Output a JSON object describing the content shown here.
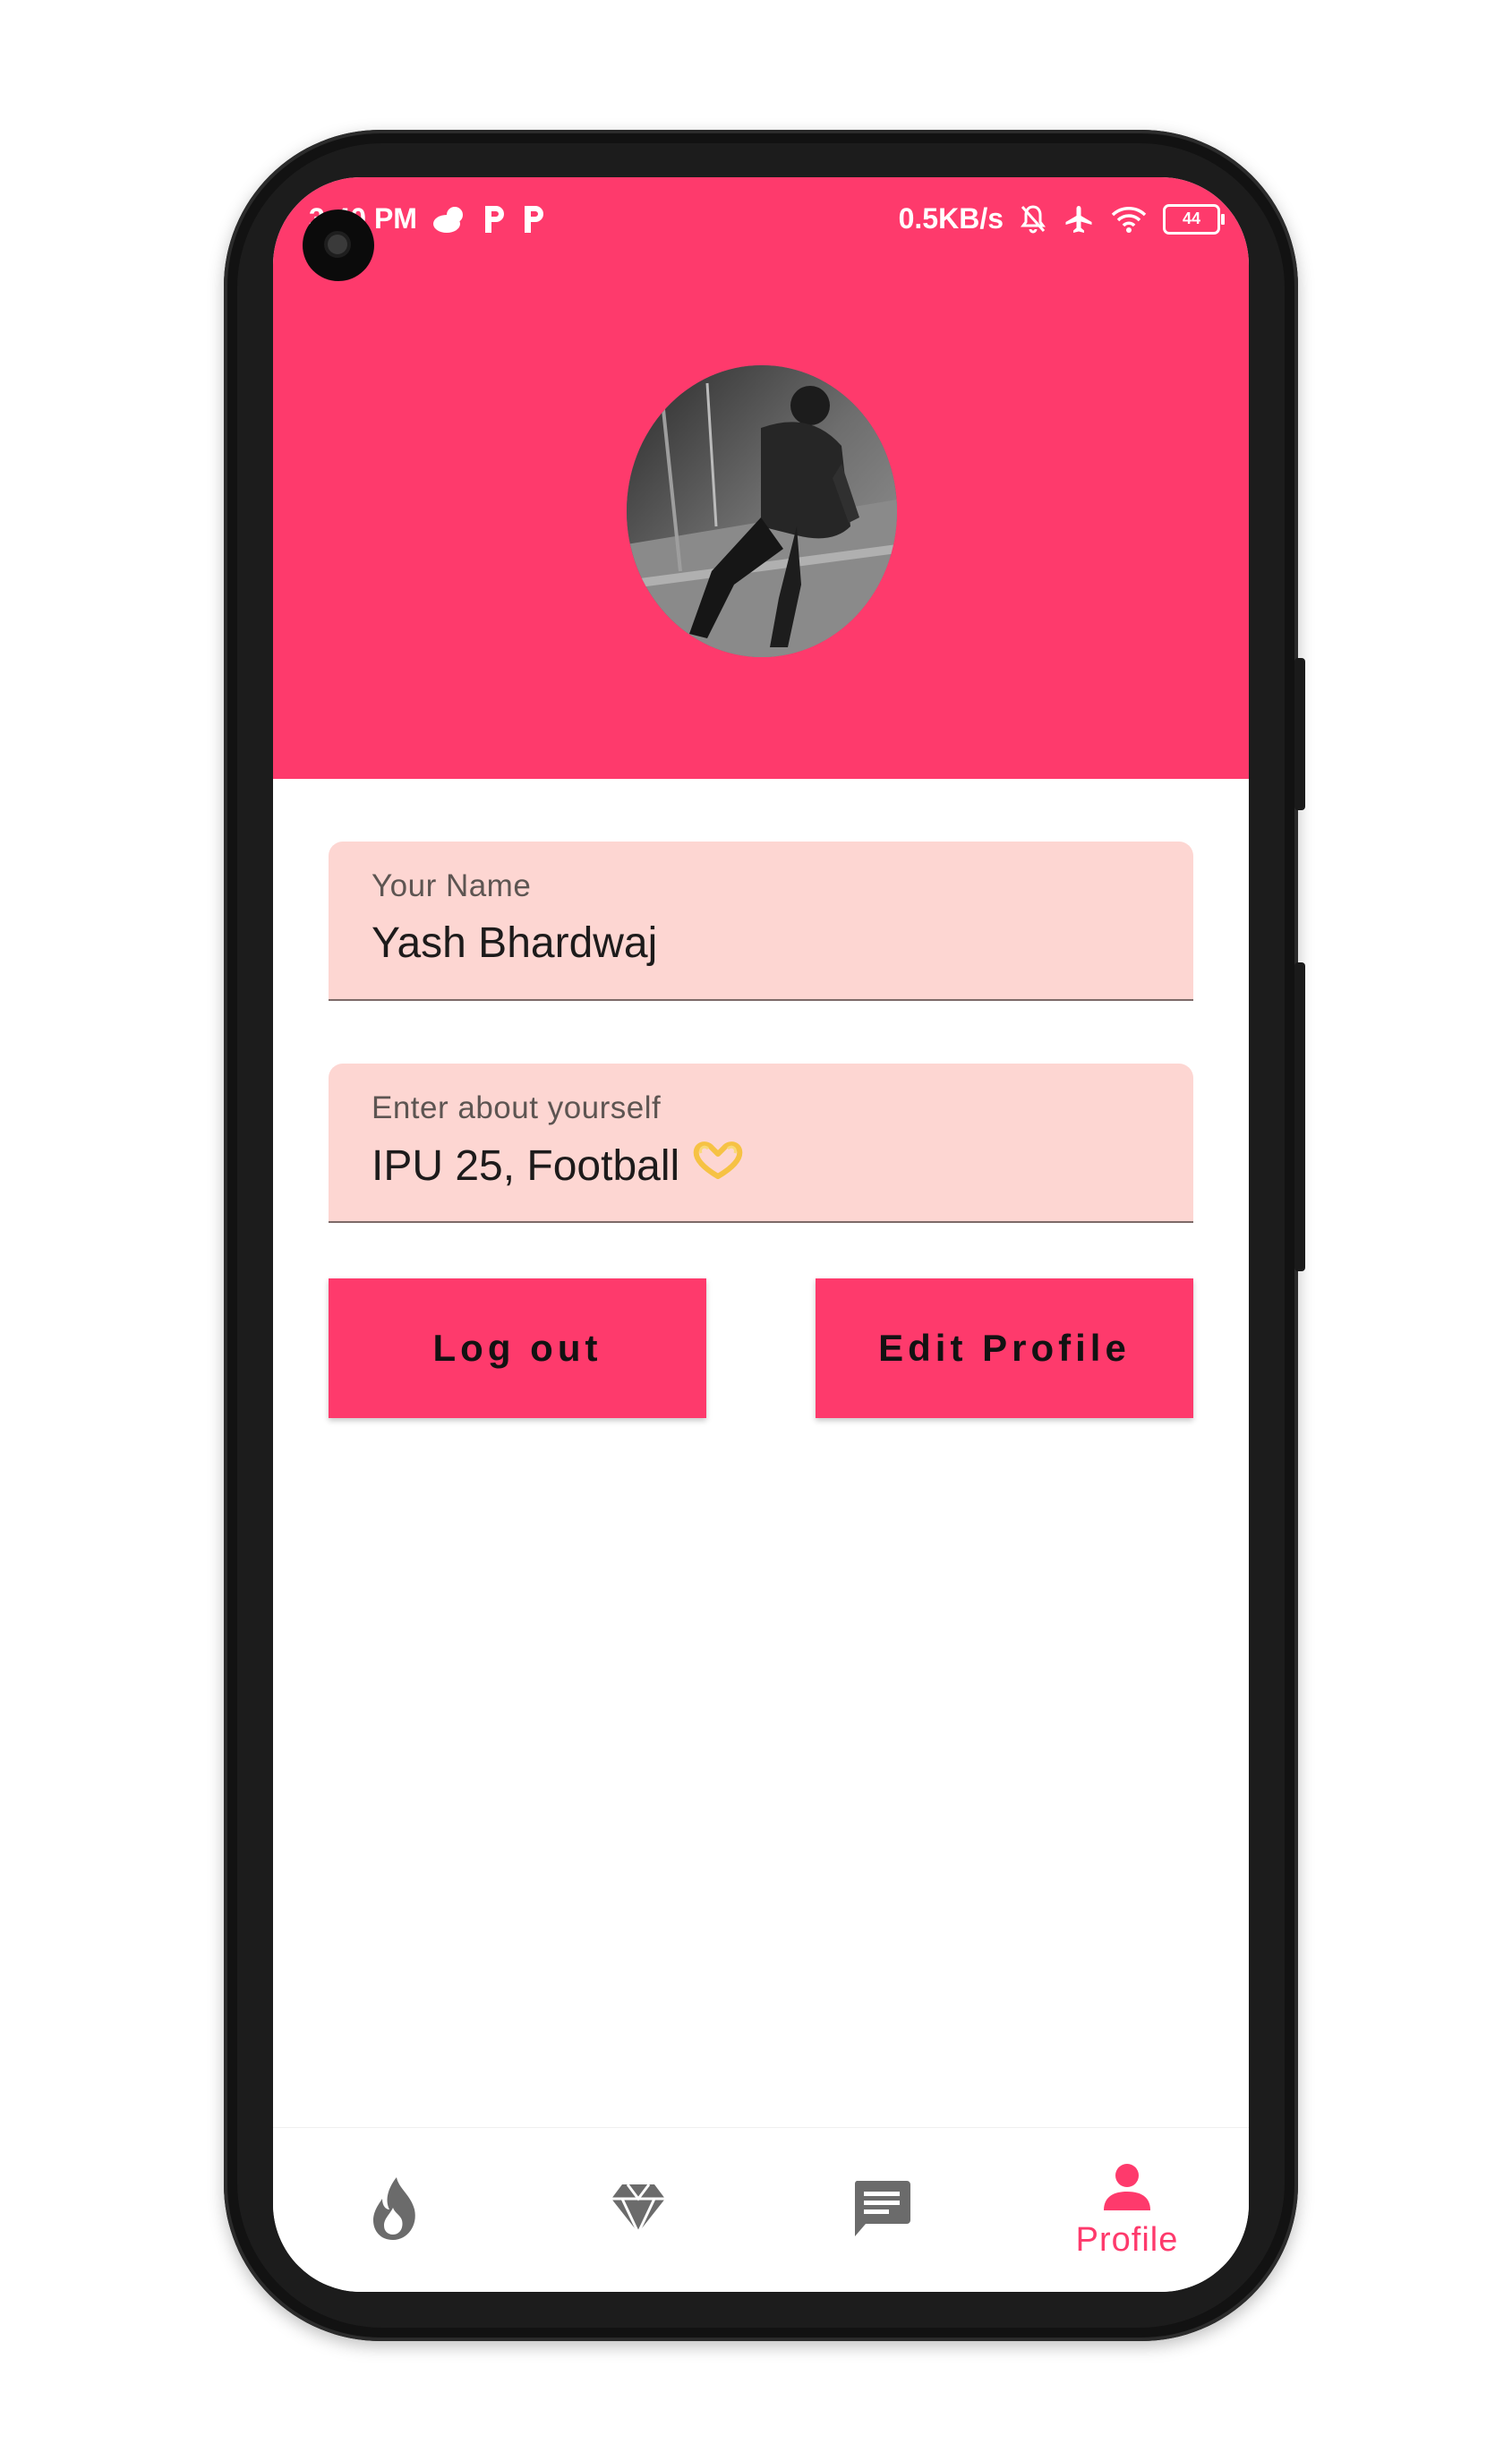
{
  "status_bar": {
    "time": "3:40 PM",
    "net_speed": "0.5KB/s",
    "battery": "44"
  },
  "profile": {
    "name_label": "Your Name",
    "name_value": "Yash Bhardwaj",
    "about_label": "Enter about yourself",
    "about_value": "IPU 25, Football",
    "about_emoji": "🫶"
  },
  "actions": {
    "logout_label": "Log out",
    "edit_label": "Edit Profile"
  },
  "nav": {
    "items": [
      {
        "icon": "flame-icon",
        "label": "",
        "active": false
      },
      {
        "icon": "diamond-icon",
        "label": "",
        "active": false
      },
      {
        "icon": "chat-icon",
        "label": "",
        "active": false
      },
      {
        "icon": "person-icon",
        "label": "Profile",
        "active": true
      }
    ]
  },
  "colors": {
    "accent": "#fe3a6c",
    "field_bg": "#fdd6d2",
    "inactive_icon": "#6b6b6b"
  }
}
